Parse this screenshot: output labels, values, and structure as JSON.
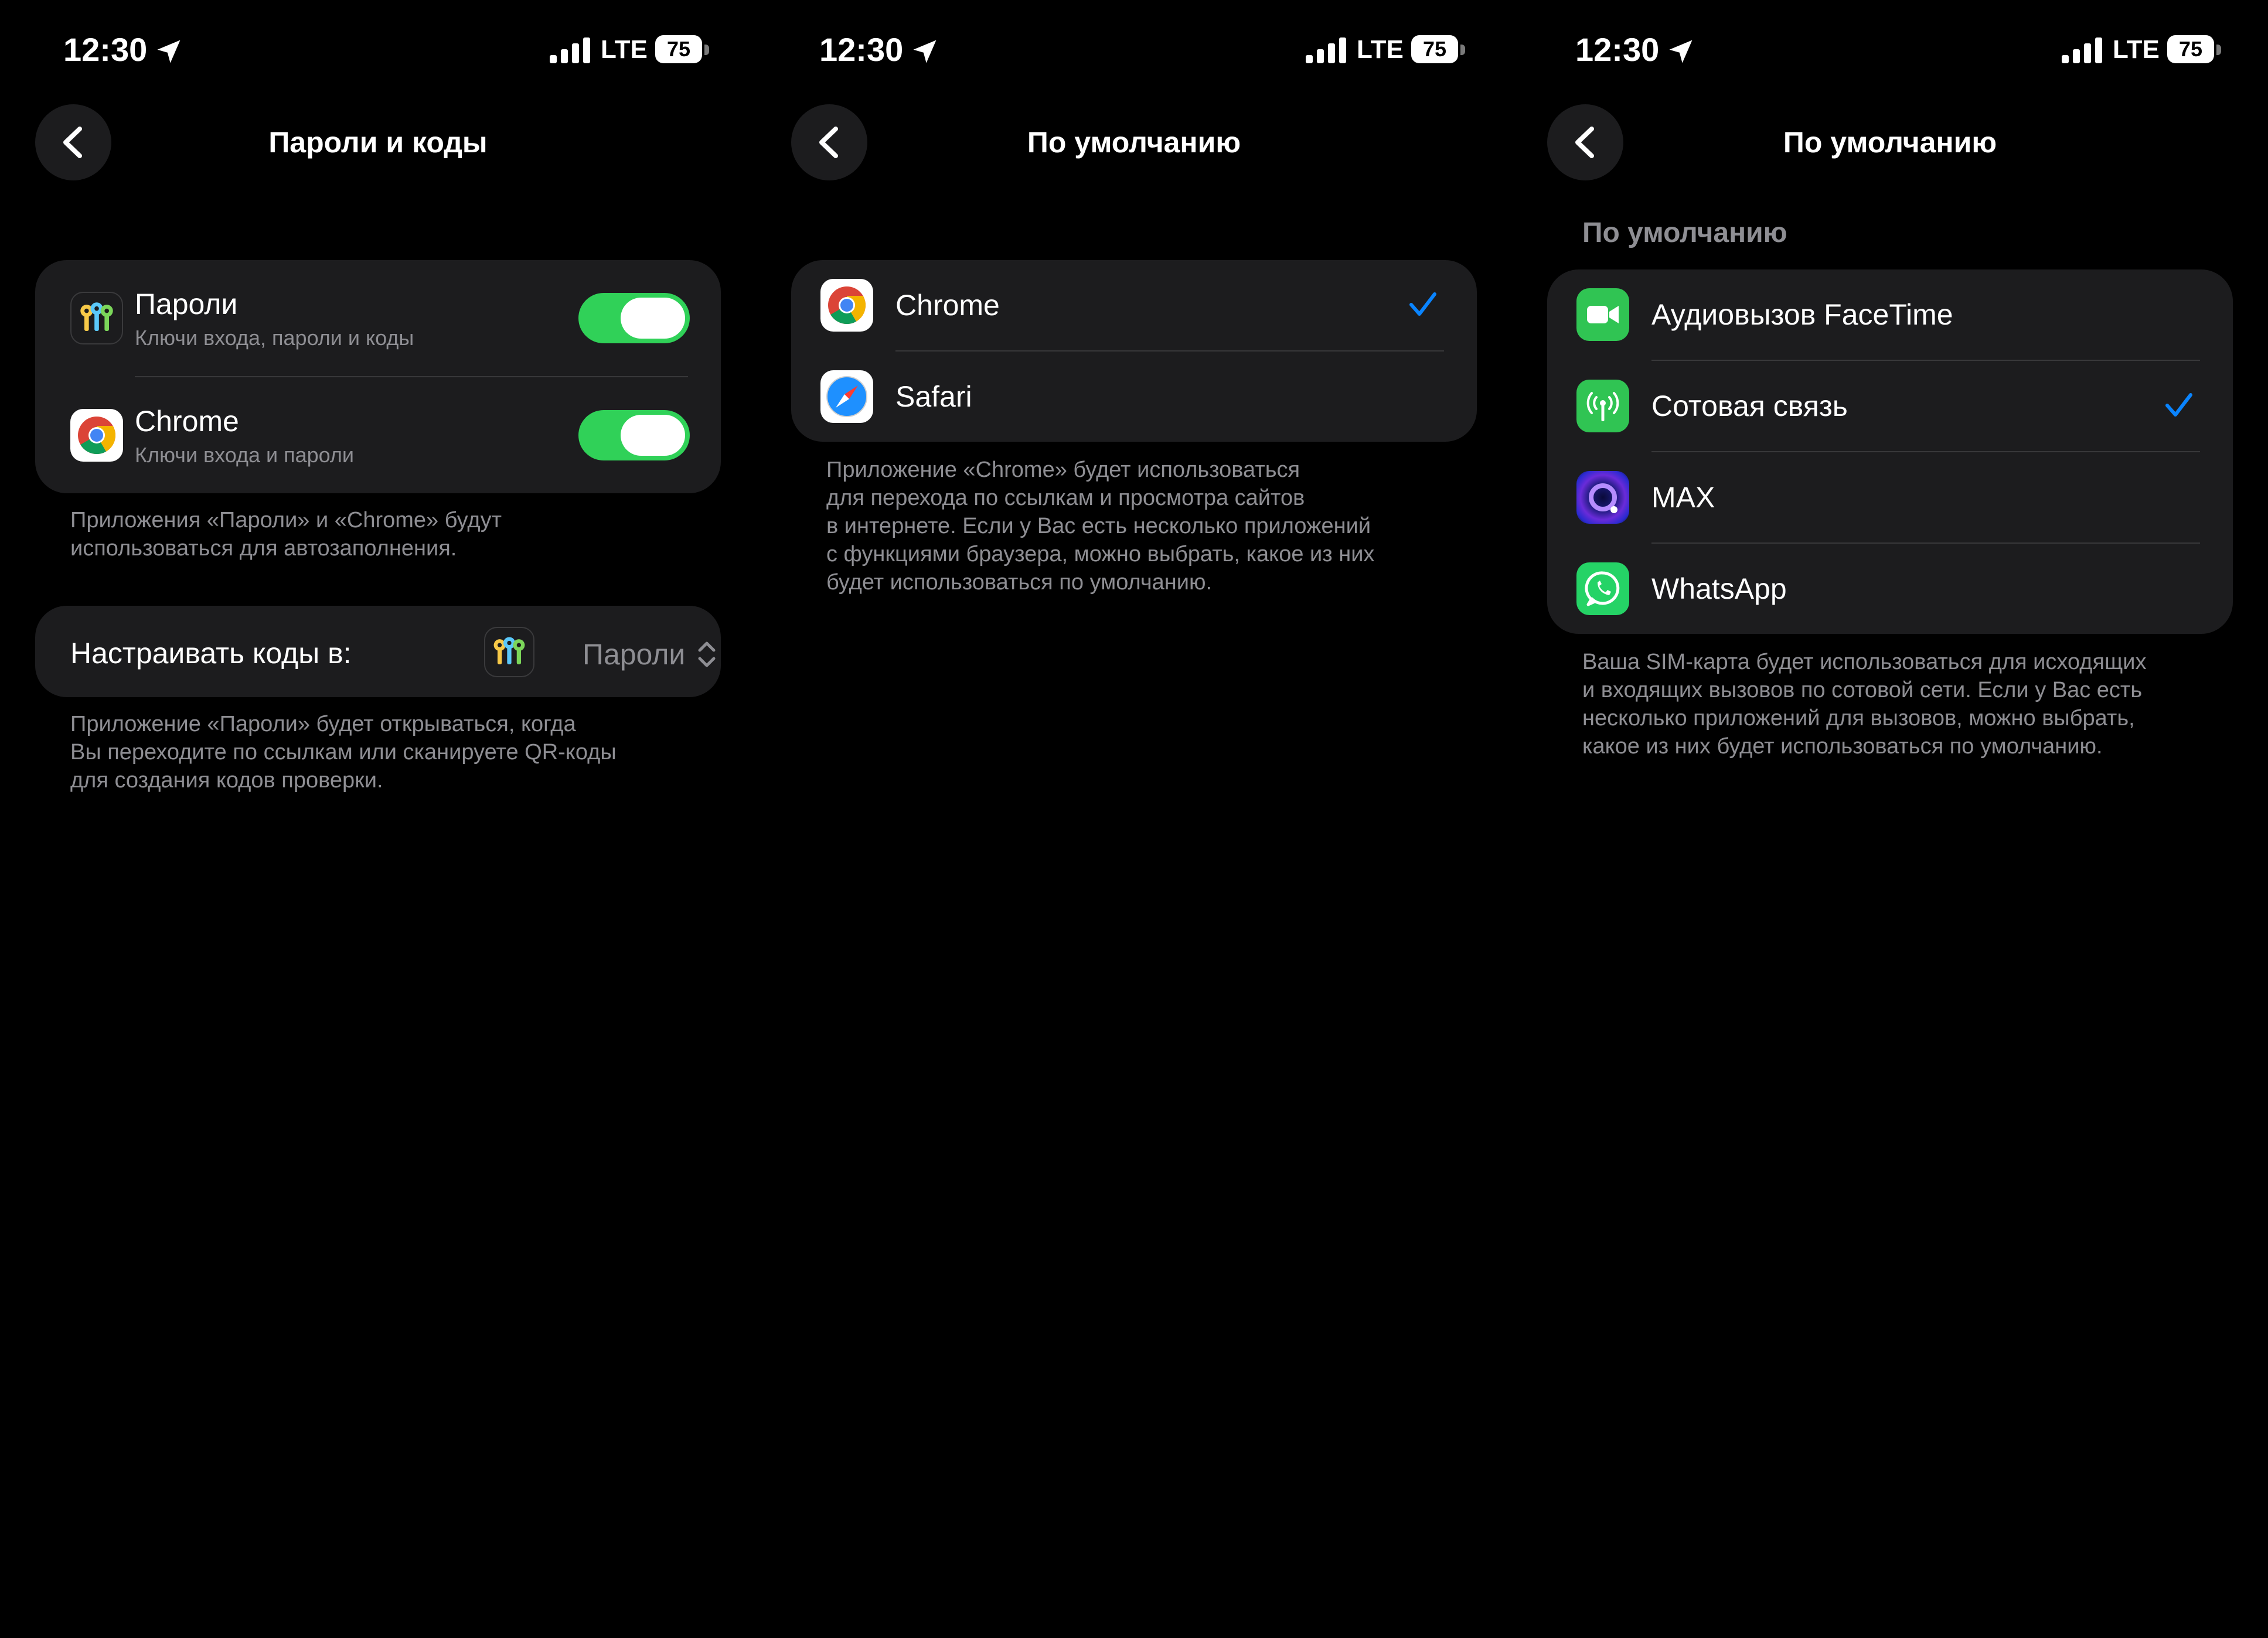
{
  "status_bar": {
    "time": "12:30",
    "network": "LTE",
    "battery": "75"
  },
  "panels": [
    {
      "title": "Пароли и коды",
      "autofill_list": [
        {
          "title": "Пароли",
          "subtitle": "Ключи входа, пароли и коды",
          "icon": "passwords-icon",
          "enabled": true
        },
        {
          "title": "Chrome",
          "subtitle": "Ключи входа и пароли",
          "icon": "chrome-icon",
          "enabled": true
        }
      ],
      "autofill_footnote_lines": [
        "Приложения «Пароли» и «Chrome» будут",
        "использоваться для автозаполнения."
      ],
      "codes_setting": {
        "label": "Настраивать коды в:",
        "value": "Пароли",
        "icon": "passwords-icon"
      },
      "codes_footnote_lines": [
        "Приложение «Пароли» будет открываться, когда",
        "Вы переходите по ссылкам или сканируете QR-коды",
        "для создания кодов проверки."
      ]
    },
    {
      "title": "По умолчанию",
      "options": [
        {
          "label": "Chrome",
          "icon": "chrome-icon",
          "selected": true
        },
        {
          "label": "Safari",
          "icon": "safari-icon",
          "selected": false
        }
      ],
      "footnote_lines": [
        "Приложение «Chrome» будет использоваться",
        "для перехода по ссылкам и просмотра сайтов",
        "в интернете. Если у Вас есть несколько приложений",
        "с функциями браузера, можно выбрать, какое из них",
        "будет использоваться по умолчанию."
      ]
    },
    {
      "title": "По умолчанию",
      "section_header": "По умолчанию",
      "options": [
        {
          "label": "Аудиовызов FaceTime",
          "icon": "facetime-icon",
          "selected": false
        },
        {
          "label": "Сотовая связь",
          "icon": "cellular-icon",
          "selected": true
        },
        {
          "label": "MAX",
          "icon": "max-icon",
          "selected": false
        },
        {
          "label": "WhatsApp",
          "icon": "whatsapp-icon",
          "selected": false
        }
      ],
      "footnote_lines": [
        "Ваша SIM-карта будет использоваться для исходящих",
        "и входящих вызовов по сотовой сети. Если у Вас есть",
        "несколько приложений для вызовов, можно выбрать,",
        "какое из них будет использоваться по умолчанию."
      ]
    }
  ],
  "colors": {
    "background": "#000000",
    "card": "#1c1c1e",
    "toggle_on": "#30d158",
    "accent": "#0a84ff",
    "secondary_text": "#8e8e93"
  }
}
